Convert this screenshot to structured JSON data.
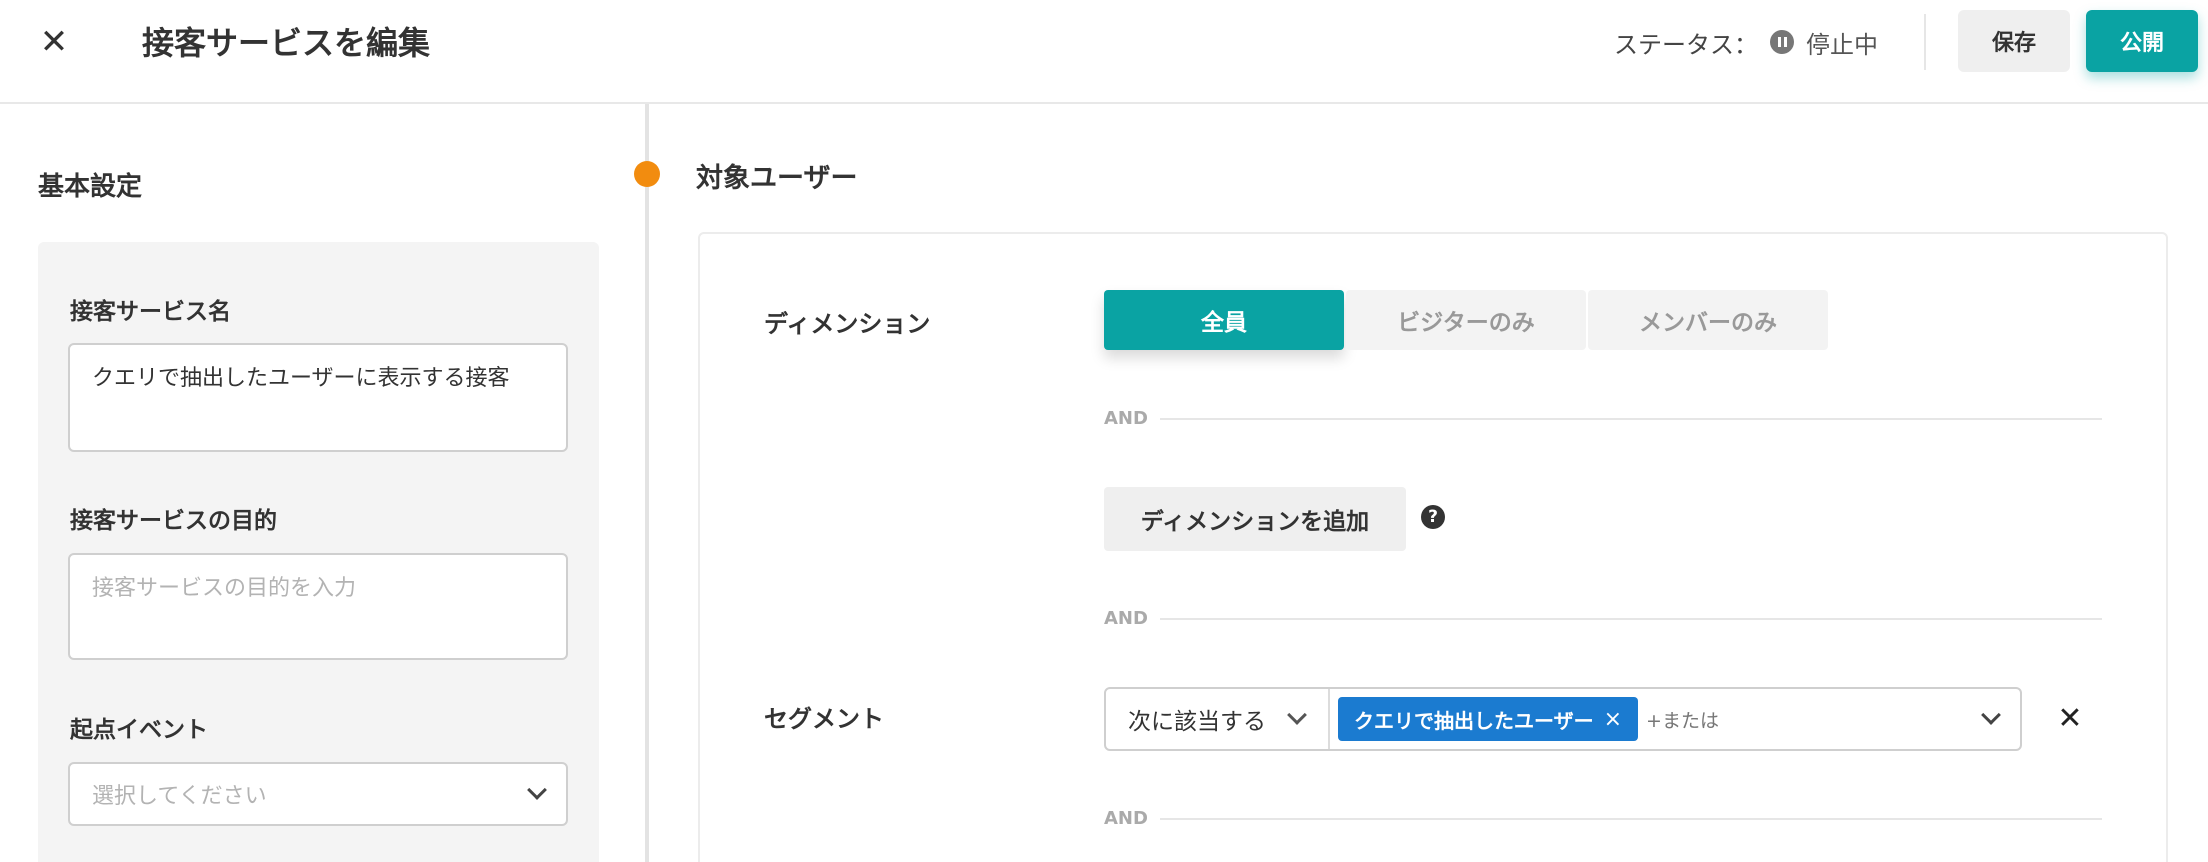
{
  "header": {
    "close_glyph": "✕",
    "title": "接客サービスを編集",
    "status_label": "ステータス：",
    "status_value": "停止中",
    "save_label": "保存",
    "publish_label": "公開"
  },
  "left": {
    "section_title": "基本設定",
    "name_label": "接客サービス名",
    "name_value": "クエリで抽出したユーザーに表示する接客",
    "purpose_label": "接客サービスの目的",
    "purpose_placeholder": "接客サービスの目的を入力",
    "trigger_label": "起点イベント",
    "trigger_placeholder": "選択してください"
  },
  "right": {
    "section_title": "対象ユーザー",
    "dimension_label": "ディメンション",
    "dimension_options": [
      "全員",
      "ビジターのみ",
      "メンバーのみ"
    ],
    "dimension_selected": "全員",
    "and_label": "AND",
    "add_dimension_label": "ディメンションを追加",
    "help_glyph": "?",
    "segment_label": "セグメント",
    "segment_condition": "次に該当する",
    "segment_chip": "クエリで抽出したユーザー",
    "chip_remove_glyph": "×",
    "or_label": "+または",
    "remove_glyph": "✕"
  },
  "colors": {
    "accent": "#0aa3a3",
    "chip": "#1b7bd0",
    "timeline_dot": "#f28c0f"
  }
}
